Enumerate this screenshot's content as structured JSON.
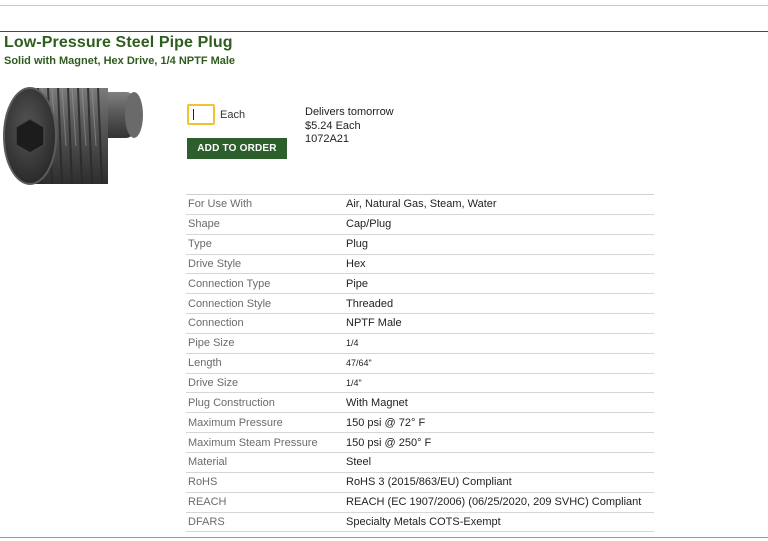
{
  "product": {
    "title": "Low-Pressure Steel Pipe Plug",
    "subtitle": "Solid with Magnet, Hex Drive, 1/4 NPTF Male"
  },
  "order": {
    "quantity": "",
    "unit_label": "Each",
    "add_button": "ADD TO ORDER",
    "delivery": "Delivers tomorrow",
    "price": "$5.24 Each",
    "part_number": "1072A21"
  },
  "specs": [
    {
      "label": "For Use With",
      "value": "Air, Natural Gas, Steam, Water"
    },
    {
      "label": "Shape",
      "value": "Cap/Plug"
    },
    {
      "label": "Type",
      "value": "Plug"
    },
    {
      "label": "Drive Style",
      "value": "Hex"
    },
    {
      "label": "Connection Type",
      "value": "Pipe"
    },
    {
      "label": "Connection Style",
      "value": "Threaded"
    },
    {
      "label": "Connection",
      "value": "NPTF Male"
    },
    {
      "label": "Pipe Size",
      "value": "1/4"
    },
    {
      "label": "Length",
      "value": "47/64\""
    },
    {
      "label": "Drive Size",
      "value": "1/4\""
    },
    {
      "label": "Plug Construction",
      "value": "With Magnet"
    },
    {
      "label": "Maximum Pressure",
      "value": "150 psi @ 72° F"
    },
    {
      "label": "Maximum Steam Pressure",
      "value": "150 psi @ 250° F"
    },
    {
      "label": "Material",
      "value": "Steel"
    },
    {
      "label": "RoHS",
      "value": "RoHS 3 (2015/863/EU) Compliant"
    },
    {
      "label": "REACH",
      "value": "REACH (EC 1907/2006) (06/25/2020, 209 SVHC) Compliant"
    },
    {
      "label": "DFARS",
      "value": "Specialty Metals COTS-Exempt"
    }
  ],
  "colors": {
    "brand_green": "#2f5c1f",
    "button_green": "#2d5f2d",
    "input_highlight": "#f2c230",
    "accent_yellow": "#f2d43a"
  },
  "icons": {
    "product_image": "hex-socket-pipe-plug"
  }
}
